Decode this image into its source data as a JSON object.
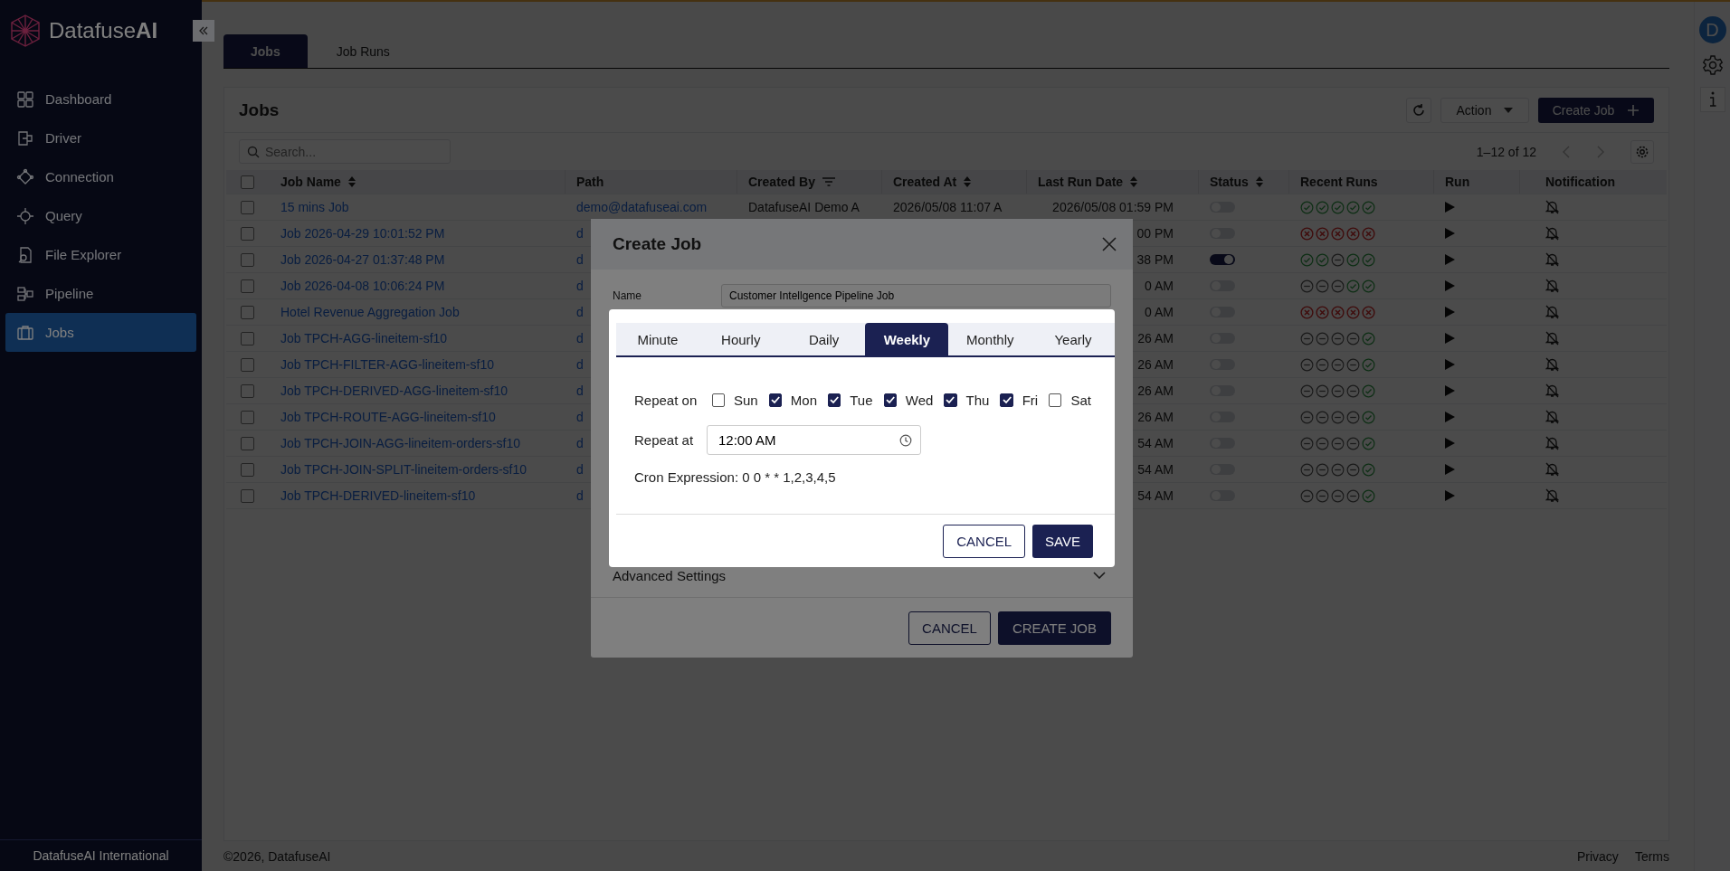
{
  "sidebar": {
    "brand": "Datafuse**AI**",
    "items": [
      {
        "label": "Dashboard",
        "selected": false
      },
      {
        "label": "Driver",
        "selected": false
      },
      {
        "label": "Connection",
        "selected": false
      },
      {
        "label": "Query",
        "selected": false
      },
      {
        "label": "File Explorer",
        "selected": false
      },
      {
        "label": "Pipeline",
        "selected": false
      },
      {
        "label": "Jobs",
        "selected": true
      }
    ],
    "footer": "DatafuseAI International"
  },
  "right_rail": {
    "avatar": "D"
  },
  "tabs": [
    {
      "label": "Jobs",
      "selected": true
    },
    {
      "label": "Job Runs",
      "selected": false
    }
  ],
  "jobs_card": {
    "title": "Jobs",
    "action_menu": "Action",
    "create_button": "Create Job",
    "search": {
      "placeholder": "Search..."
    },
    "pagination": "1–12 of 12"
  },
  "table": {
    "select_all_checked": false,
    "columns": [
      {
        "label": "Job Name",
        "kind": "sortable"
      },
      {
        "label": "Path",
        "kind": "plain"
      },
      {
        "label": "Created By",
        "kind": "filterable"
      },
      {
        "label": "Created At",
        "kind": "sortable"
      },
      {
        "label": "Last Run Date",
        "kind": "sortable"
      },
      {
        "label": "Status",
        "kind": "sortable"
      },
      {
        "label": "Recent Runs",
        "kind": "plain"
      },
      {
        "label": "Run",
        "kind": "plain"
      },
      {
        "label": "Notification",
        "kind": "plain"
      }
    ],
    "rows": [
      {
        "checked": false,
        "job_name": "15 mins Job",
        "path": "demo@datafuseai.com",
        "created_by": "DatafuseAI Demo A",
        "created_at": "2026/05/08 11:07 A",
        "last_run_date": "2026/05/08 01:59 PM",
        "status_on": false,
        "recent_runs": [
          {
            "kind": "success"
          },
          {
            "kind": "success"
          },
          {
            "kind": "success"
          },
          {
            "kind": "success"
          },
          {
            "kind": "success"
          }
        ]
      },
      {
        "checked": false,
        "job_name": "Job 2026-04-29 10:01:52 PM",
        "path": "d",
        "last_run_date": "00 PM",
        "status_on": false,
        "recent_runs": [
          {
            "kind": "failed"
          },
          {
            "kind": "failed"
          },
          {
            "kind": "failed"
          },
          {
            "kind": "failed"
          },
          {
            "kind": "failed"
          }
        ]
      },
      {
        "checked": false,
        "job_name": "Job 2026-04-27 01:37:48 PM",
        "path": "d",
        "last_run_date": "38 PM",
        "status_on": true,
        "recent_runs": [
          {
            "kind": "success"
          },
          {
            "kind": "success"
          },
          {
            "kind": "skipped"
          },
          {
            "kind": "success"
          },
          {
            "kind": "success"
          }
        ]
      },
      {
        "checked": false,
        "job_name": "Job 2026-04-08 10:06:24 PM",
        "path": "d",
        "last_run_date": "0 AM",
        "status_on": false,
        "recent_runs": [
          {
            "kind": "skipped"
          },
          {
            "kind": "skipped"
          },
          {
            "kind": "skipped"
          },
          {
            "kind": "success"
          },
          {
            "kind": "success"
          }
        ]
      },
      {
        "checked": false,
        "job_name": "Hotel Revenue Aggregation Job",
        "path": "d",
        "last_run_date": "0 AM",
        "status_on": false,
        "recent_runs": [
          {
            "kind": "failed"
          },
          {
            "kind": "failed"
          },
          {
            "kind": "failed"
          },
          {
            "kind": "failed"
          },
          {
            "kind": "failed"
          }
        ]
      },
      {
        "checked": false,
        "job_name": "Job TPCH-AGG-lineitem-sf10",
        "path": "d",
        "last_run_date": "26 AM",
        "status_on": false,
        "recent_runs": [
          {
            "kind": "skipped"
          },
          {
            "kind": "skipped"
          },
          {
            "kind": "skipped"
          },
          {
            "kind": "skipped"
          },
          {
            "kind": "success"
          }
        ]
      },
      {
        "checked": false,
        "job_name": "Job TPCH-FILTER-AGG-lineitem-sf10",
        "path": "d",
        "last_run_date": "26 AM",
        "status_on": false,
        "recent_runs": [
          {
            "kind": "skipped"
          },
          {
            "kind": "skipped"
          },
          {
            "kind": "skipped"
          },
          {
            "kind": "skipped"
          },
          {
            "kind": "success"
          }
        ]
      },
      {
        "checked": false,
        "job_name": "Job TPCH-DERIVED-AGG-lineitem-sf10",
        "path": "d",
        "last_run_date": "26 AM",
        "status_on": false,
        "recent_runs": [
          {
            "kind": "skipped"
          },
          {
            "kind": "skipped"
          },
          {
            "kind": "skipped"
          },
          {
            "kind": "skipped"
          },
          {
            "kind": "success"
          }
        ]
      },
      {
        "checked": false,
        "job_name": "Job TPCH-ROUTE-AGG-lineitem-sf10",
        "path": "d",
        "last_run_date": "26 AM",
        "status_on": false,
        "recent_runs": [
          {
            "kind": "skipped"
          },
          {
            "kind": "skipped"
          },
          {
            "kind": "skipped"
          },
          {
            "kind": "skipped"
          },
          {
            "kind": "success"
          }
        ]
      },
      {
        "checked": false,
        "job_name": "Job TPCH-JOIN-AGG-lineitem-orders-sf10",
        "path": "d",
        "last_run_date": "54 AM",
        "status_on": false,
        "recent_runs": [
          {
            "kind": "skipped"
          },
          {
            "kind": "skipped"
          },
          {
            "kind": "skipped"
          },
          {
            "kind": "skipped"
          },
          {
            "kind": "success"
          }
        ]
      },
      {
        "checked": false,
        "job_name": "Job TPCH-JOIN-SPLIT-lineitem-orders-sf10",
        "path": "d",
        "last_run_date": "54 AM",
        "status_on": false,
        "recent_runs": [
          {
            "kind": "skipped"
          },
          {
            "kind": "skipped"
          },
          {
            "kind": "skipped"
          },
          {
            "kind": "skipped"
          },
          {
            "kind": "success"
          }
        ]
      },
      {
        "checked": false,
        "job_name": "Job TPCH-DERIVED-lineitem-sf10",
        "path": "d",
        "last_run_date": "54 AM",
        "status_on": false,
        "recent_runs": [
          {
            "kind": "skipped"
          },
          {
            "kind": "skipped"
          },
          {
            "kind": "skipped"
          },
          {
            "kind": "skipped"
          },
          {
            "kind": "success"
          }
        ]
      }
    ]
  },
  "create_job_dialog": {
    "title": "Create Job",
    "name_label": "Name",
    "name_value": "Customer Intellgence Pipeline Job",
    "advanced_label": "Advanced Settings",
    "cancel": "CANCEL",
    "submit": "CREATE JOB"
  },
  "schedule_dialog": {
    "tabs": [
      {
        "label": "Minute",
        "selected": false
      },
      {
        "label": "Hourly",
        "selected": false
      },
      {
        "label": "Daily",
        "selected": false
      },
      {
        "label": "Weekly",
        "selected": true
      },
      {
        "label": "Monthly",
        "selected": false
      },
      {
        "label": "Yearly",
        "selected": false
      }
    ],
    "repeat_on_label": "Repeat on",
    "days": [
      {
        "label": "Sun",
        "checked": false
      },
      {
        "label": "Mon",
        "checked": true
      },
      {
        "label": "Tue",
        "checked": true
      },
      {
        "label": "Wed",
        "checked": true
      },
      {
        "label": "Thu",
        "checked": true
      },
      {
        "label": "Fri",
        "checked": true
      },
      {
        "label": "Sat",
        "checked": false
      }
    ],
    "repeat_at_label": "Repeat at",
    "time_value": "12:00 AM",
    "cron": "Cron Expression: 0 0 * * 1,2,3,4,5",
    "cancel": "CANCEL",
    "save": "SAVE"
  },
  "footer": {
    "copyright": "©2026, DatafuseAI",
    "links": [
      "Privacy",
      "Terms"
    ]
  }
}
